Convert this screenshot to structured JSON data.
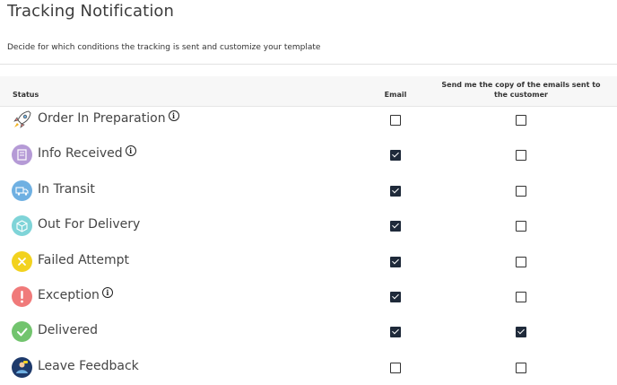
{
  "header": {
    "title": "Tracking Notification",
    "subtitle": "Decide for which conditions the tracking is sent and customize your template"
  },
  "table": {
    "columns": {
      "status": "Status",
      "email": "Email",
      "copy": "Send me the copy of the emails sent to the customer"
    },
    "rows": [
      {
        "label": "Order In Preparation",
        "info": "i",
        "icon": "rocket-icon",
        "color": "#ffffff",
        "email": false,
        "copy": false
      },
      {
        "label": "Info Received",
        "info": "i",
        "icon": "document-icon",
        "color": "#b59ad6",
        "email": true,
        "copy": false
      },
      {
        "label": "In Transit",
        "info": "",
        "icon": "truck-icon",
        "color": "#6fb0e2",
        "email": true,
        "copy": false
      },
      {
        "label": "Out For Delivery",
        "info": "",
        "icon": "box-icon",
        "color": "#7fd4d8",
        "email": true,
        "copy": false
      },
      {
        "label": "Failed Attempt",
        "info": "",
        "icon": "x-mark-icon",
        "color": "#f2d21f",
        "email": true,
        "copy": false
      },
      {
        "label": "Exception",
        "info": "i",
        "icon": "exclamation-icon",
        "color": "#f07a7a",
        "email": true,
        "copy": false
      },
      {
        "label": "Delivered",
        "info": "",
        "icon": "checkmark-icon",
        "color": "#72c46e",
        "email": true,
        "copy": true
      },
      {
        "label": "Leave Feedback",
        "info": "",
        "icon": "person-feedback-icon",
        "color": "#1e3a6b",
        "email": false,
        "copy": false
      }
    ]
  }
}
